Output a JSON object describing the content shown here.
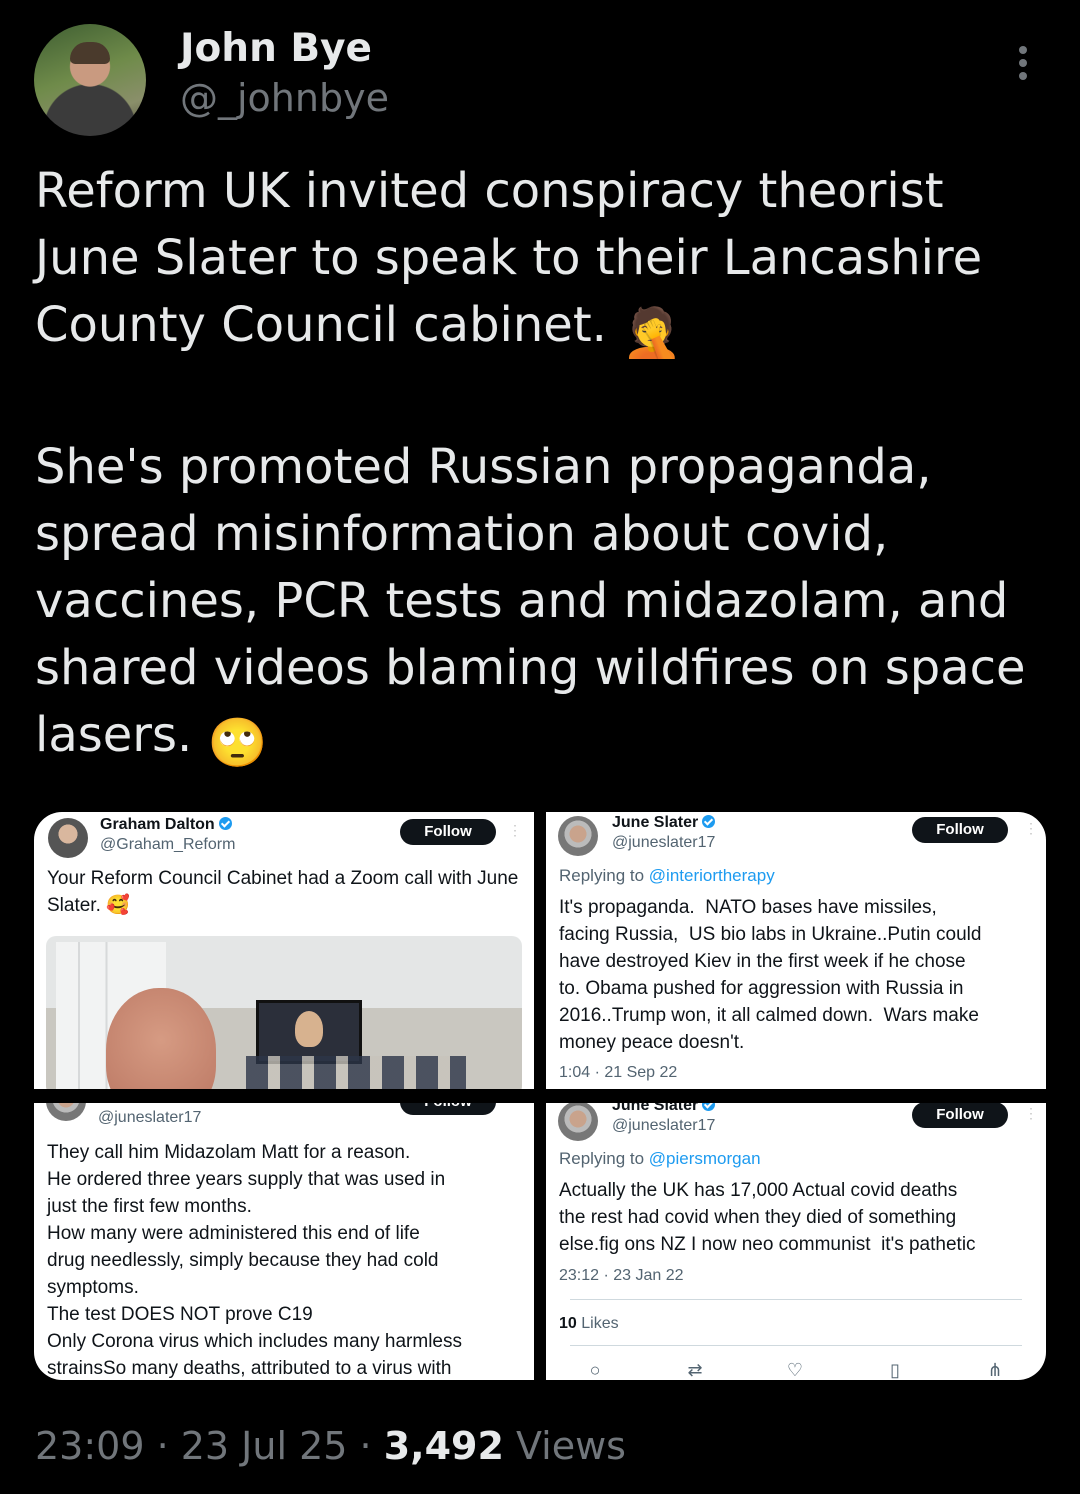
{
  "author": {
    "name": "John Bye",
    "handle": "@_johnbye"
  },
  "tweet": {
    "paragraph1": "Reform UK invited conspiracy theorist June Slater to speak to their Lancashire County Council cabinet.",
    "emoji1": "🤦",
    "paragraph2": "She's promoted Russian propaganda, spread misinformation about covid, vaccines, PCR tests and midazolam, and shared videos blaming wildfires on space lasers.",
    "emoji2": "🙄"
  },
  "media": {
    "tile1": {
      "name": "Graham Dalton",
      "handle": "@Graham_Reform",
      "follow": "Follow",
      "text": "Your Reform Council Cabinet had a Zoom call with June Slater.",
      "emoji": "🥰"
    },
    "tile2": {
      "name": "June Slater",
      "handle": "@juneslater17",
      "follow": "Follow",
      "replying_prefix": "Replying to ",
      "replying_to": "@interiortherapy",
      "text": "It's propaganda.  NATO bases have missiles,\nfacing Russia,  US bio labs in Ukraine..Putin could\nhave destroyed Kiev in the first week if he chose\nto. Obama pushed for aggression with Russia in\n2016..Trump won, it all calmed down.  Wars make\nmoney peace doesn't.",
      "time": "1:04 · 21 Sep 22"
    },
    "tile3": {
      "handle": "@juneslater17",
      "follow": "Follow",
      "text": "They call him Midazolam Matt for a reason.\nHe ordered three years supply that was used in\njust the first few months.\nHow many were administered this end of life\ndrug needlessly, simply because they had cold\nsymptoms.\nThe test DOES NOT prove C19\nOnly Corona virus which includes many harmless\nstrainsSo many deaths, attributed to a virus with"
    },
    "tile4": {
      "name": "June Slater",
      "handle": "@juneslater17",
      "follow": "Follow",
      "replying_prefix": "Replying to ",
      "replying_to": "@piersmorgan",
      "text": "Actually the UK has 17,000 Actual covid deaths\nthe rest had covid when they died of something\nelse.fig ons NZ I now neo communist  it's pathetic",
      "time": "23:12 · 23 Jan 22",
      "likes_count": "10",
      "likes_label": " Likes"
    }
  },
  "footer": {
    "time": "23:09 · 23 Jul 25 · ",
    "views_count": "3,492",
    "views_label": " Views"
  },
  "colors": {
    "background": "#000000",
    "text": "#e7e9ea",
    "muted": "#71767b",
    "link": "#1d9bf0"
  }
}
